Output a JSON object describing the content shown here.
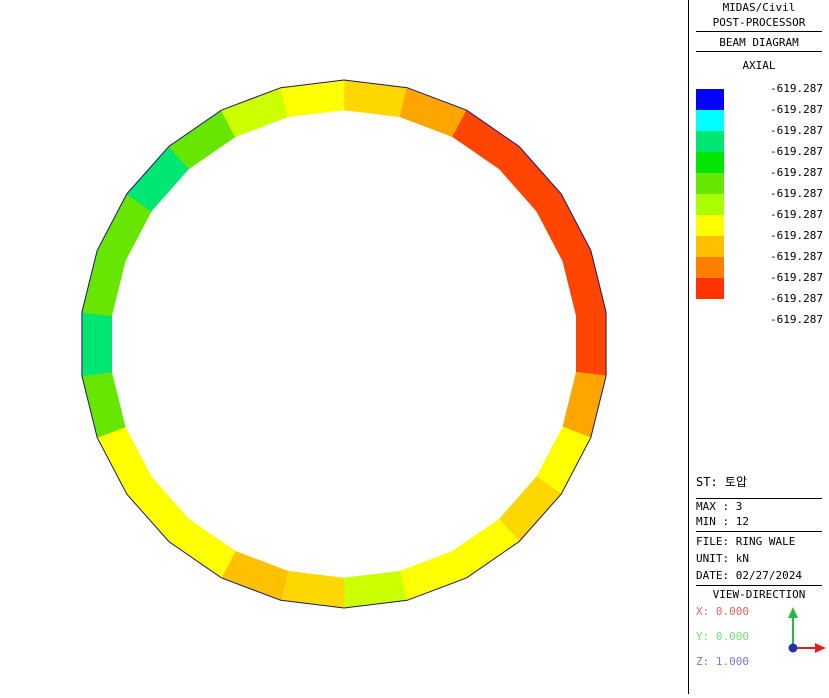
{
  "header": {
    "line1": "MIDAS/Civil",
    "line2": "POST-PROCESSOR",
    "diagram_type": "BEAM DIAGRAM",
    "component": "AXIAL"
  },
  "legend": {
    "colors": [
      "#0000ff",
      "#00ffff",
      "#00e673",
      "#00e600",
      "#66e600",
      "#aaff00",
      "#ffff00",
      "#ffc000",
      "#ff8000",
      "#ff3300"
    ],
    "values": [
      "-619.287",
      "-619.287",
      "-619.287",
      "-619.287",
      "-619.287",
      "-619.287",
      "-619.287",
      "-619.287",
      "-619.287",
      "-619.287",
      "-619.287",
      "-619.287"
    ]
  },
  "status": {
    "st": "ST: 토압",
    "max": "MAX : 3",
    "min": "MIN : 12",
    "file": "FILE: RING WALE",
    "unit": "UNIT: kN",
    "date": "DATE: 02/27/2024",
    "view_direction_label": "VIEW-DIRECTION",
    "x": "X: 0.000",
    "y": "Y: 0.000",
    "z": "Z: 1.000"
  },
  "ring": {
    "segments": [
      "#ffd700",
      "#ffa500",
      "#ff4500",
      "#ff4500",
      "#ff4500",
      "#ff4500",
      "#ff4500",
      "#ffa500",
      "#ffff00",
      "#ffd700",
      "#ffff00",
      "#ffff00",
      "#ccff00",
      "#ffd700",
      "#ffc000",
      "#ffff00",
      "#ffff00",
      "#ffff00",
      "#66e600",
      "#00e673",
      "#66e600",
      "#66e600",
      "#00e673",
      "#66e600",
      "#ccff00",
      "#ffff00"
    ]
  },
  "colors": {
    "axis_x": "#dd2222",
    "axis_y": "#22bb44",
    "axis_z": "#2233aa",
    "text_x": "#dd6666",
    "text_y": "#77dd77",
    "text_z": "#7777cc"
  }
}
